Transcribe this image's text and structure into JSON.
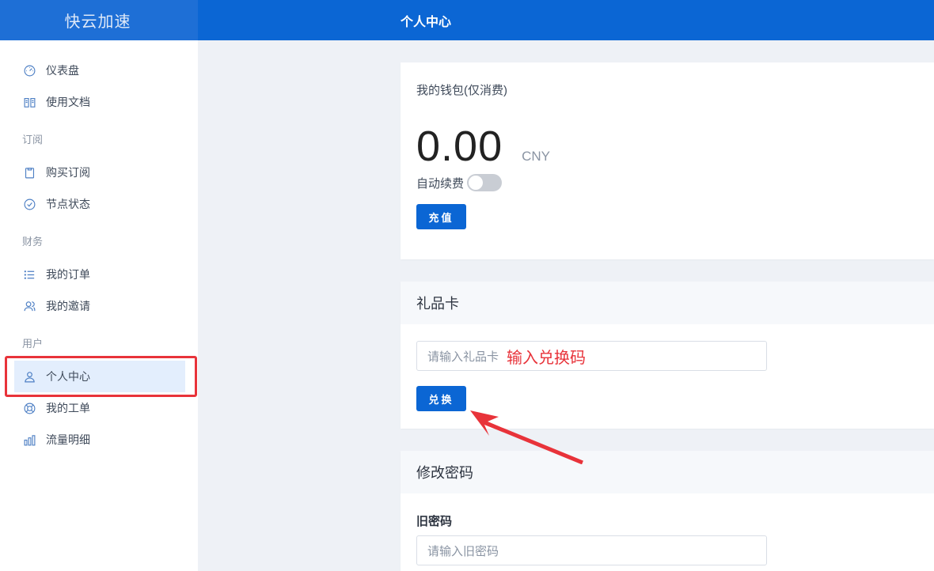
{
  "brand": "快云加速",
  "topbar": {
    "title": "个人中心"
  },
  "sidebar": {
    "items_top": [
      {
        "label": "仪表盘",
        "icon": "gauge-icon"
      },
      {
        "label": "使用文档",
        "icon": "book-icon"
      }
    ],
    "sections": [
      {
        "title": "订阅",
        "items": [
          {
            "label": "购买订阅",
            "icon": "clipboard-icon"
          },
          {
            "label": "节点状态",
            "icon": "check-circle-icon"
          }
        ]
      },
      {
        "title": "财务",
        "items": [
          {
            "label": "我的订单",
            "icon": "list-icon"
          },
          {
            "label": "我的邀请",
            "icon": "users-icon"
          }
        ]
      },
      {
        "title": "用户",
        "items": [
          {
            "label": "个人中心",
            "icon": "user-icon",
            "active": true
          },
          {
            "label": "我的工单",
            "icon": "lifebuoy-icon"
          },
          {
            "label": "流量明细",
            "icon": "bar-chart-icon"
          }
        ]
      }
    ]
  },
  "wallet": {
    "title": "我的钱包(仅消费)",
    "balance": "0.00",
    "currency": "CNY",
    "auto_renew_label": "自动续费",
    "auto_renew_on": false,
    "recharge_label": "充值"
  },
  "giftcard": {
    "title": "礼品卡",
    "placeholder": "请输入礼品卡",
    "annotation": "输入兑换码",
    "redeem_label": "兑换"
  },
  "password": {
    "title": "修改密码",
    "old_label": "旧密码",
    "old_placeholder": "请输入旧密码"
  },
  "colors": {
    "primary": "#0b66d4",
    "annotation_red": "#e8333a"
  }
}
